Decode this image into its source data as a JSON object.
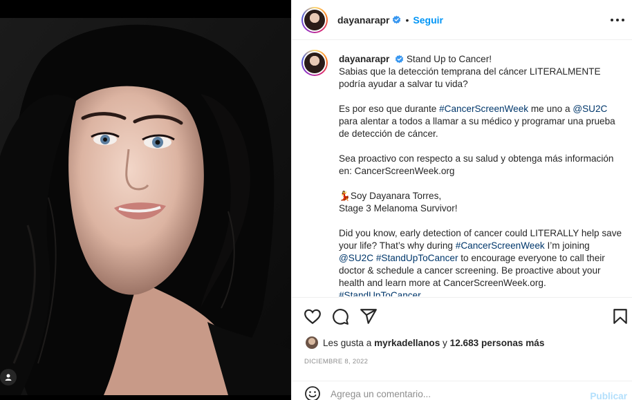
{
  "post": {
    "username": "dayanarapr",
    "follow_label": "Seguir",
    "dot": "•",
    "caption": {
      "username": "dayanarapr",
      "segments": [
        {
          "t": "Stand Up to Cancer!\nSabias que la detección temprana del cáncer LITERALMENTE podría ayudar a salvar tu vida?\n\nEs por eso que durante "
        },
        {
          "t": "#CancerScreenWeek",
          "tag": true
        },
        {
          "t": " me uno a "
        },
        {
          "t": "@SU2C",
          "tag": true
        },
        {
          "t": " para alentar a todos a llamar a su médico y programar una prueba de detección de cáncer.\n\nSea proactivo con respecto a su salud y obtenga más información en: CancerScreenWeek.org\n\n💃Soy Dayanara Torres,\nStage 3 Melanoma Survivor!\n\nDid you know, early detection of cancer could LITERALLY help save your life? That’s why during "
        },
        {
          "t": "#CancerScreenWeek",
          "tag": true
        },
        {
          "t": " I’m joining "
        },
        {
          "t": "@SU2C",
          "tag": true
        },
        {
          "t": " "
        },
        {
          "t": "#StandUpToCancer",
          "tag": true
        },
        {
          "t": " to encourage everyone to call their doctor & schedule a cancer screening. Be proactive about your health and learn more at CancerScreenWeek.org.\n"
        },
        {
          "t": "#StandUpToCancer",
          "tag": true
        }
      ]
    },
    "likes": {
      "prefix": "Les gusta a ",
      "user": "myrkadellanos",
      "middle": " y ",
      "count": "12.683 personas más"
    },
    "date": "DICIEMBRE 8, 2022",
    "comment_placeholder": "Agrega un comentario...",
    "publish_label": "Publicar"
  },
  "icons": [
    "heart-icon",
    "comment-icon",
    "share-icon",
    "bookmark-icon",
    "more-icon",
    "verified-icon",
    "emoji-icon",
    "user-tag-icon"
  ],
  "colors": {
    "link": "#0095f6",
    "tag": "#00376b",
    "muted": "#8e8e8e",
    "publish_disabled": "#b2dffc"
  }
}
